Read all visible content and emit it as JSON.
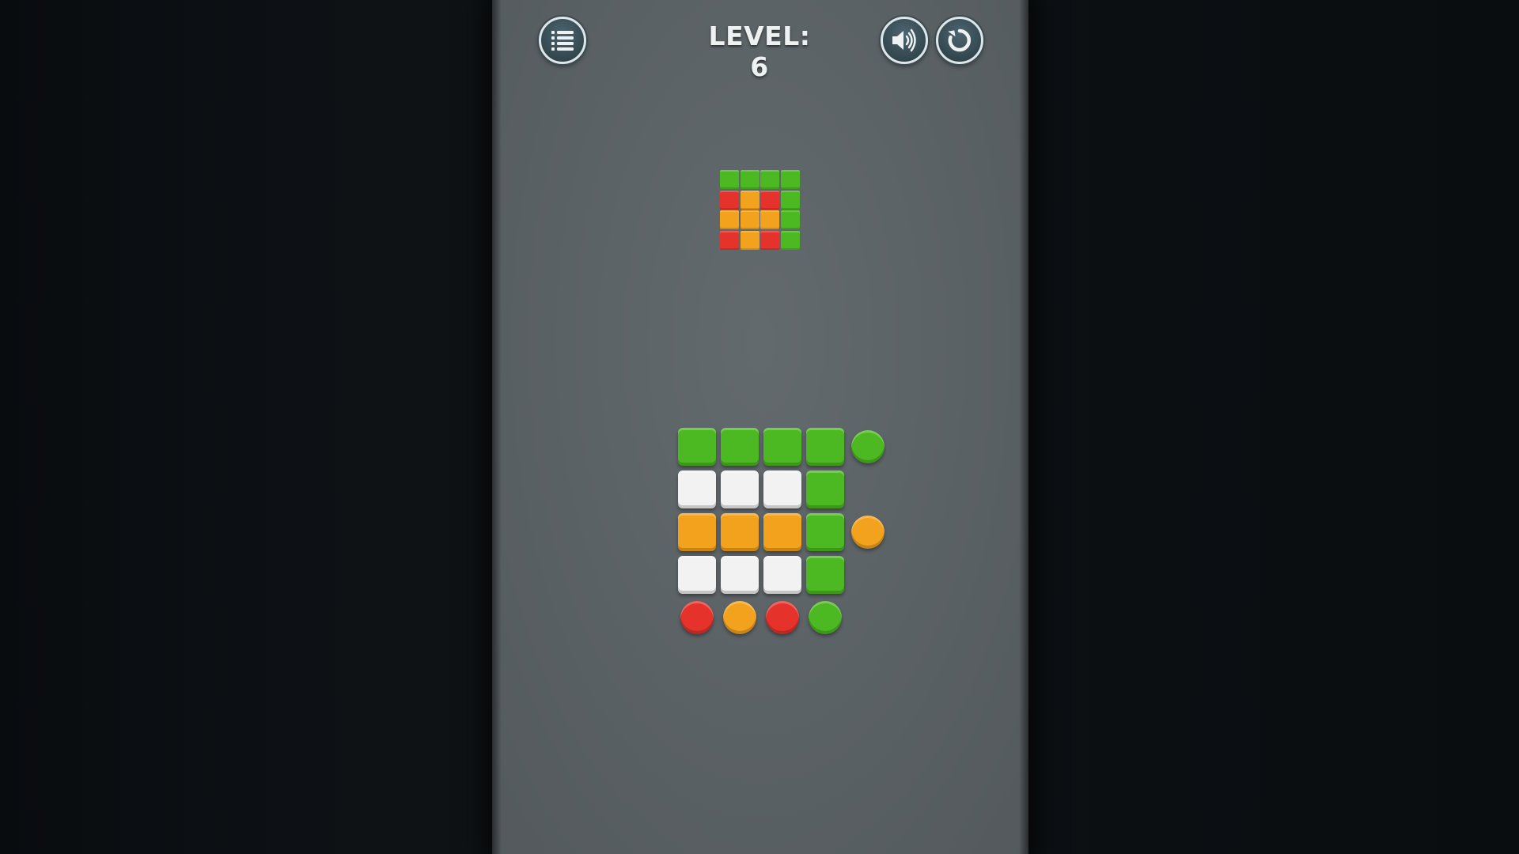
{
  "header": {
    "level_text": "LEVEL: 6",
    "menu_icon": "list-icon",
    "sound_icon": "speaker-icon",
    "restart_icon": "restart-icon"
  },
  "colors": {
    "green": "#4cb822",
    "orange": "#f3a21e",
    "red": "#e5332b",
    "white": "#f2f2f2",
    "panel": "#5c6367"
  },
  "target_pattern": [
    [
      "green",
      "green",
      "green",
      "green"
    ],
    [
      "red",
      "orange",
      "red",
      "green"
    ],
    [
      "orange",
      "orange",
      "orange",
      "green"
    ],
    [
      "red",
      "orange",
      "red",
      "green"
    ]
  ],
  "board": [
    [
      "green",
      "green",
      "green",
      "green"
    ],
    [
      "white",
      "white",
      "white",
      "green"
    ],
    [
      "orange",
      "orange",
      "orange",
      "green"
    ],
    [
      "white",
      "white",
      "white",
      "green"
    ]
  ],
  "row_buttons": [
    "green",
    null,
    "orange",
    null
  ],
  "column_buttons": [
    "red",
    "orange",
    "red",
    "green"
  ]
}
